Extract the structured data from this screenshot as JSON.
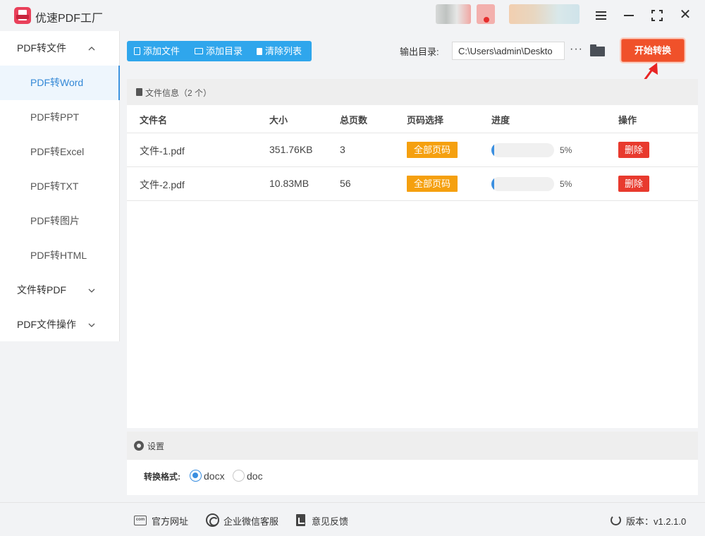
{
  "app": {
    "title": "优速PDF工厂"
  },
  "sidebar": {
    "groups": [
      {
        "label": "PDF转文件",
        "chevron": "^",
        "items": [
          {
            "label": "PDF转Word",
            "active": true
          },
          {
            "label": "PDF转PPT"
          },
          {
            "label": "PDF转Excel"
          },
          {
            "label": "PDF转TXT"
          },
          {
            "label": "PDF转图片"
          },
          {
            "label": "PDF转HTML"
          }
        ]
      },
      {
        "label": "文件转PDF",
        "chevron": "v"
      },
      {
        "label": "PDF文件操作",
        "chevron": "v"
      }
    ]
  },
  "toolbar": {
    "add_file": "添加文件",
    "add_dir": "添加目录",
    "clear_list": "清除列表",
    "output_label": "输出目录:",
    "output_path": "C:\\Users\\admin\\Deskto",
    "more": "···",
    "start": "开始转换"
  },
  "file_panel": {
    "title": "文件信息（2 个）",
    "columns": [
      "文件名",
      "大小",
      "总页数",
      "页码选择",
      "进度",
      "操作"
    ],
    "rows": [
      {
        "name": "文件-1.pdf",
        "size": "351.76KB",
        "pages": "3",
        "page_select": "全部页码",
        "progress": 5,
        "progress_text": "5%",
        "action": "删除"
      },
      {
        "name": "文件-2.pdf",
        "size": "10.83MB",
        "pages": "56",
        "page_select": "全部页码",
        "progress": 5,
        "progress_text": "5%",
        "action": "删除"
      }
    ]
  },
  "settings": {
    "title": "设置",
    "format_label": "转换格式:",
    "options": [
      {
        "label": "docx",
        "selected": true
      },
      {
        "label": "doc",
        "selected": false
      }
    ]
  },
  "footer": {
    "website": "官方网址",
    "wechat": "企业微信客服",
    "feedback": "意见反馈",
    "version": "版本：v1.2.1.0",
    "com_icon_text": "com"
  },
  "colors": {
    "accent_blue": "#2fa6ec",
    "start_orange": "#f0512a",
    "badge_orange": "#f5a00f",
    "delete_red": "#e83a2e",
    "progress_blue": "#3b8fe0",
    "arrow_red": "#e82525"
  }
}
